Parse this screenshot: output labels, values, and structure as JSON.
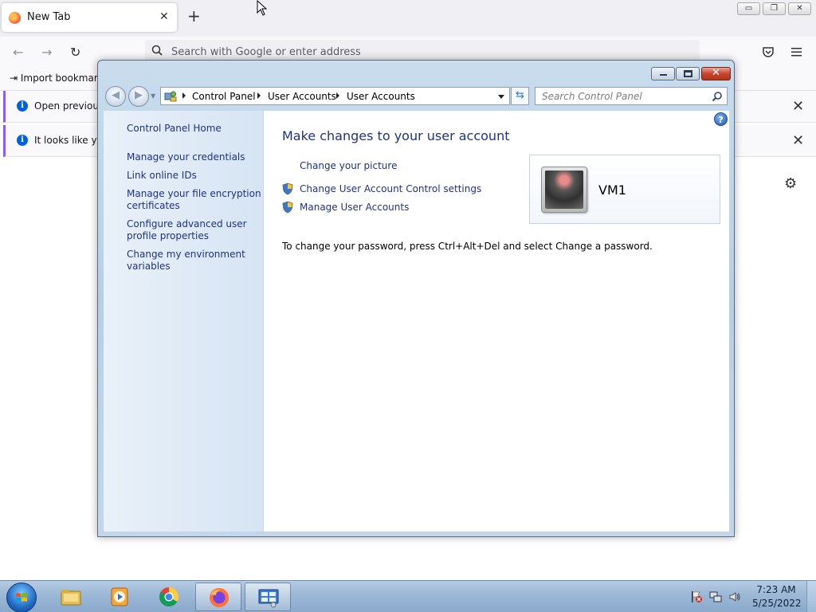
{
  "firefox": {
    "tab_title": "New Tab",
    "tab_close": "✕",
    "new_tab": "+",
    "window_buttons": {
      "minimize": "▭",
      "restore": "❐",
      "close": "✕"
    },
    "nav": {
      "back": "←",
      "forward": "→",
      "reload": "↻"
    },
    "url_placeholder": "Search with Google or enter address",
    "toolbar_icons": [
      "pocket-icon",
      "menu-icon"
    ],
    "import_bookmarks": "Import bookmark",
    "notifications": [
      {
        "text": "Open previous",
        "close": "✕"
      },
      {
        "text": "It looks like you",
        "close": "✕"
      }
    ],
    "settings_icon": "⚙"
  },
  "control_panel": {
    "breadcrumb": [
      "Control Panel",
      "User Accounts",
      "User Accounts"
    ],
    "search_placeholder": "Search Control Panel",
    "help": "?",
    "tasks": [
      "Control Panel Home",
      "Manage your credentials",
      "Link online IDs",
      "Manage your file encryption certificates",
      "Configure advanced user profile properties",
      "Change my environment variables"
    ],
    "heading": "Make changes to your user account",
    "links": [
      {
        "label": "Change your picture",
        "shield": false
      },
      {
        "label": "Change User Account Control settings",
        "shield": true
      },
      {
        "label": "Manage User Accounts",
        "shield": true
      }
    ],
    "note": "To change your password, press Ctrl+Alt+Del and select Change a password.",
    "user": {
      "name": "VM1"
    }
  },
  "taskbar": {
    "items": [
      "windows-explorer",
      "media-player",
      "chrome",
      "firefox",
      "control-panel"
    ],
    "active_item": "control-panel",
    "clock": {
      "time": "7:23 AM",
      "date": "5/25/2022"
    }
  },
  "colors": {
    "link": "#1e3287",
    "firefox_accent": "#9059ff",
    "info_blue": "#0060df"
  }
}
